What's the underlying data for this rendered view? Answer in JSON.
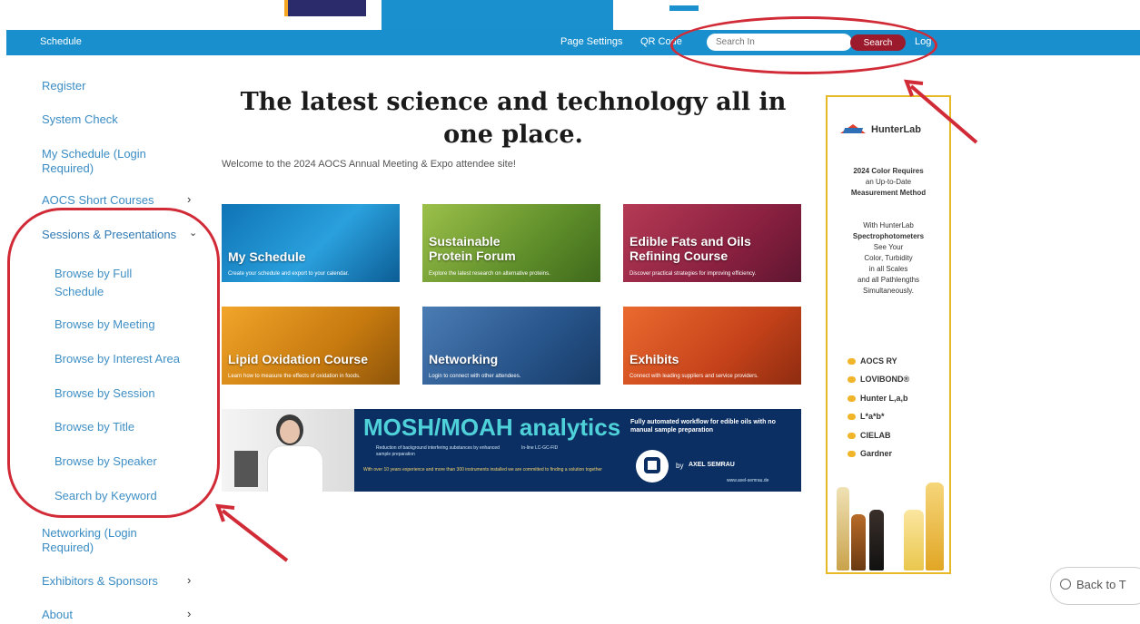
{
  "nav": {
    "schedule": "Schedule",
    "page_settings": "Page Settings",
    "qr_code": "QR Code",
    "search_placeholder": "Search In",
    "search_button": "Search",
    "login": "Log"
  },
  "sidebar": {
    "items": [
      {
        "label": "Register"
      },
      {
        "label": "System Check"
      },
      {
        "label": "My Schedule (Login Required)"
      },
      {
        "label": "AOCS Short Courses"
      },
      {
        "label": "Sessions & Presentations"
      },
      {
        "label": "Browse by Full Schedule"
      },
      {
        "label": "Browse by Meeting"
      },
      {
        "label": "Browse by Interest Area"
      },
      {
        "label": "Browse by Session"
      },
      {
        "label": "Browse by Title"
      },
      {
        "label": "Browse by Speaker"
      },
      {
        "label": "Search by Keyword"
      },
      {
        "label": "Networking (Login Required)"
      },
      {
        "label": "Exhibitors & Sponsors"
      },
      {
        "label": "About"
      }
    ]
  },
  "main": {
    "headline": "The latest science and technology all in one place.",
    "welcome": "Welcome to the 2024 AOCS Annual Meeting & Expo attendee site!",
    "tiles": [
      {
        "title": "My Schedule",
        "subtitle": "Create your schedule and export to your calendar.",
        "color": "#1b8fcc"
      },
      {
        "title": "Sustainable Protein Forum",
        "subtitle": "Explore the latest research on alternative proteins.",
        "color": "#7aa93a"
      },
      {
        "title": "Edible Fats and Oils Refining Course",
        "subtitle": "Discover practical strategies for improving efficiency.",
        "color": "#9a2745"
      },
      {
        "title": "Lipid Oxidation Course",
        "subtitle": "Learn how to measure the effects of oxidation in foods.",
        "color": "#d98a15"
      },
      {
        "title": "Networking",
        "subtitle": "Login to connect with other attendees.",
        "color": "#2d5f9a"
      },
      {
        "title": "Exhibits",
        "subtitle": "Connect with leading suppliers and service providers.",
        "color": "#cf4a1f"
      }
    ],
    "banner": {
      "title": "MOSH/MOAH analytics",
      "tagline": "Fully automated workflow for edible oils with no manual sample preparation",
      "bullets": [
        "Reduction of background interfering substances by enhanced sample preparation",
        "In-line LC-GC-FID"
      ],
      "note": "With over 10 years experience and more than 300 instruments installed we are committed to finding a solution together",
      "by": "by",
      "company": "AXEL SEMRAU",
      "url": "www.axel-semrau.de"
    }
  },
  "ad": {
    "brand": "HunterLab",
    "lines": [
      "2024 Color Requires",
      "an Up-to-Date",
      "Measurement Method",
      "",
      "With HunterLab",
      "Spectrophotometers",
      "See Your",
      "Color, Turbidity",
      "in all Scales",
      "and all Pathlengths",
      "Simultaneously."
    ],
    "scales": [
      "AOCS RY",
      "LOVIBOND®",
      "Hunter L,a,b",
      "L*a*b*",
      "CIELAB",
      "Gardner"
    ]
  },
  "back_to_top": "Back to T",
  "colors": {
    "nav_blue": "#1a8fcd",
    "search_red": "#9b1a2c",
    "annotation_red": "#d12b37",
    "ad_border": "#e8b825",
    "link_blue": "#3a8cc4"
  }
}
